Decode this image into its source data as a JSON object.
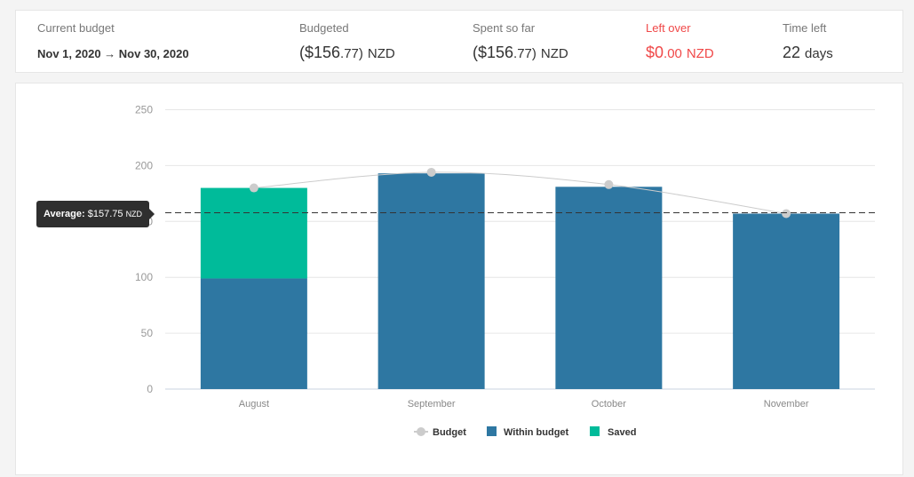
{
  "summary": {
    "current_budget": {
      "label": "Current budget",
      "value": "Nov 1, 2020 → Nov 30, 2020"
    },
    "budgeted": {
      "label": "Budgeted",
      "main": "($156",
      "cents": ".77)",
      "currency": "NZD"
    },
    "spent": {
      "label": "Spent so far",
      "main": "($156",
      "cents": ".77)",
      "currency": "NZD"
    },
    "left_over": {
      "label": "Left over",
      "main": "$0",
      "cents": ".00",
      "currency": "NZD"
    },
    "time_left": {
      "label": "Time left",
      "main": "22",
      "unit": "days"
    }
  },
  "tooltip": {
    "label": "Average:",
    "value": "$157.75",
    "currency": "NZD"
  },
  "colors": {
    "within": "#2e77a2",
    "saved": "#00bb9a",
    "budget": "#cccccc",
    "left_over": "#f04848"
  },
  "chart_data": {
    "type": "bar",
    "stacked": true,
    "categories": [
      "August",
      "September",
      "October",
      "November"
    ],
    "series": [
      {
        "name": "Within budget",
        "values": [
          99,
          193,
          181,
          157
        ]
      },
      {
        "name": "Saved",
        "values": [
          81,
          0,
          0,
          0
        ]
      }
    ],
    "line_series": {
      "name": "Budget",
      "values": [
        180,
        194,
        183,
        157
      ]
    },
    "average_line": 157.75,
    "yticks": [
      0,
      50,
      100,
      150,
      200,
      250
    ],
    "ylim": [
      0,
      250
    ],
    "grid": true,
    "legend": "bottom"
  }
}
